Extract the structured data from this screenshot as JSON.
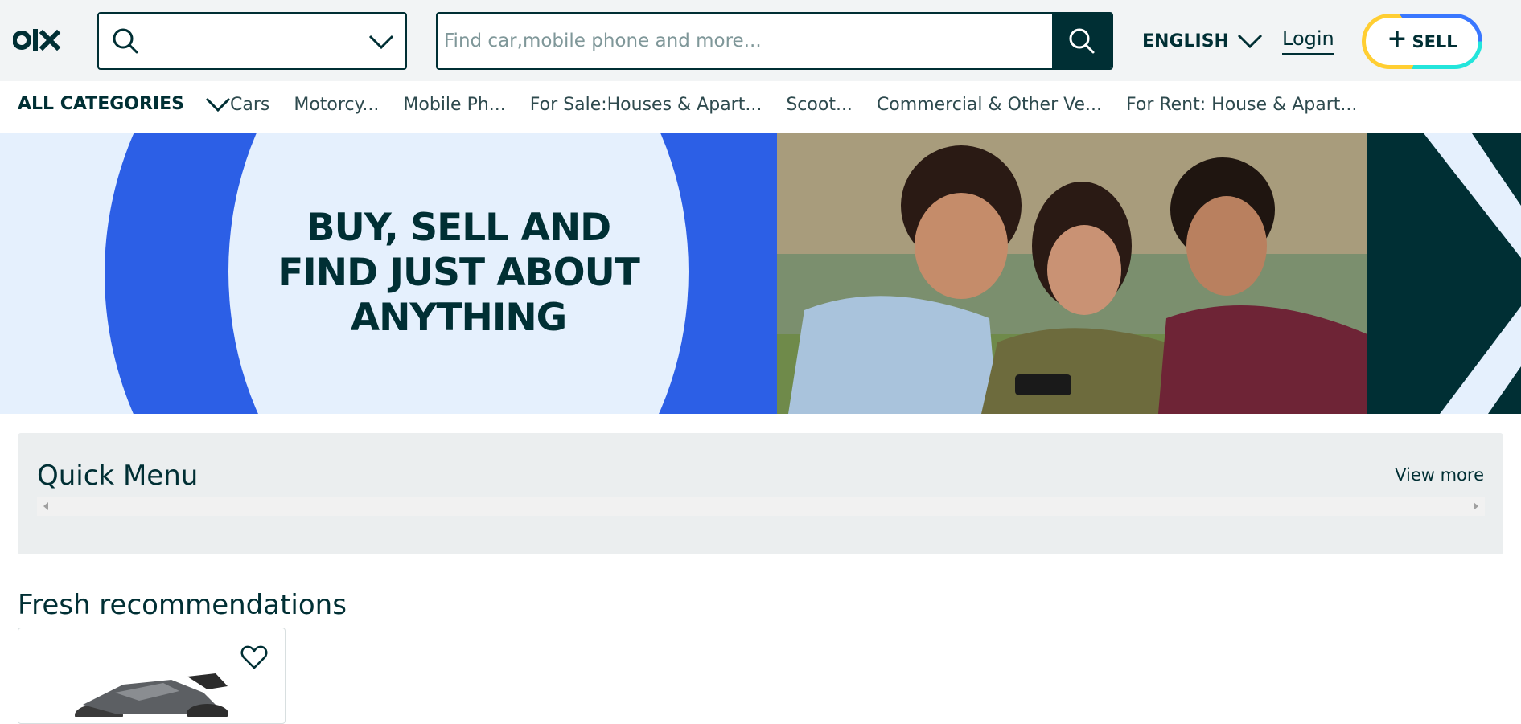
{
  "header": {
    "location_placeholder": "",
    "search_placeholder": "Find car,mobile phone and more...",
    "language_label": "ENGLISH",
    "login_label": "Login",
    "sell_label": "SELL",
    "sell_plus": "+"
  },
  "categories": {
    "all_label": "ALL CATEGORIES",
    "items": [
      "Cars",
      "Motorcy...",
      "Mobile Ph...",
      "For Sale:Houses & Apart...",
      "Scoot...",
      "Commercial & Other Ve...",
      "For Rent: House & Apart..."
    ]
  },
  "banner": {
    "line1": "BUY, SELL AND",
    "line2": "FIND JUST ABOUT",
    "line3": "ANYTHING"
  },
  "quick_menu": {
    "title": "Quick Menu",
    "view_more": "View more"
  },
  "fresh": {
    "title": "Fresh recommendations"
  },
  "colors": {
    "brand_dark": "#002f34",
    "banner_blue": "#2c5fe6",
    "banner_light": "#e5f0fd",
    "sell_yellow": "#ffce32",
    "sell_blue": "#3a77ff",
    "sell_teal": "#23e5db"
  },
  "icons": [
    "olx-logo",
    "search-icon",
    "chevron-down-icon",
    "heart-icon"
  ]
}
